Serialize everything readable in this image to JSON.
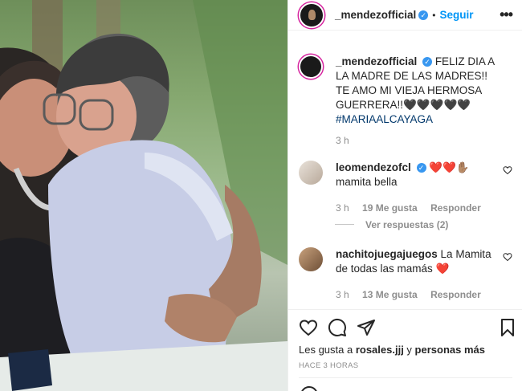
{
  "post": {
    "author": "_mendezofficial",
    "verified_mark": "✓",
    "separator": "•",
    "follow_label": "Seguir",
    "more_label": "•••"
  },
  "caption": {
    "author": "_mendezofficial",
    "text": "FELIZ DIA A LA MADRE DE LAS MADRES!! TE AMO MI VIEJA HERMOSA GUERRERA!!🖤🖤🖤🖤🖤",
    "hashtag": "#MARIAALCAYAGA",
    "time": "3 h"
  },
  "comments": [
    {
      "author": "leomendezofcl",
      "text": "❤️❤️✋🏽",
      "text2": "mamita bella",
      "time": "3 h",
      "likes": "19 Me gusta",
      "reply": "Responder"
    },
    {
      "author": "nachitojuegajuegos",
      "text": "La Mamita de todas las mamás ❤️",
      "time": "3 h",
      "likes": "13 Me gusta",
      "reply": "Responder"
    }
  ],
  "view_replies": "Ver respuestas (2)",
  "likes_line": {
    "prefix": "Les gusta a ",
    "user": "rosales.jjj",
    "middle": " y ",
    "others": "personas más"
  },
  "timestamp": "HACE 3 HORAS",
  "icons": {
    "like": "heart-icon",
    "comment": "comment-icon",
    "share": "send-icon",
    "save": "bookmark-icon"
  },
  "colors": {
    "link": "#0095f6",
    "verified": "#3897f0",
    "hashtag": "#00376b",
    "muted": "#8e8e8e"
  }
}
